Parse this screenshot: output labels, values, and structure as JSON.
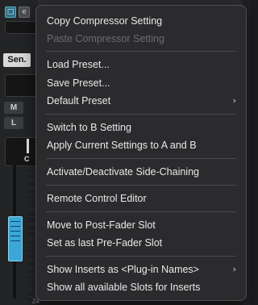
{
  "background": {
    "send_label": "Sen.",
    "mute_label": "M",
    "listen_label": "L",
    "channel_label": "C",
    "scale_label": "24"
  },
  "menu": {
    "items": [
      {
        "label": "Copy Compressor Setting",
        "enabled": true
      },
      {
        "label": "Paste Compressor Setting",
        "enabled": false
      },
      {
        "label": "Load Preset...",
        "enabled": true
      },
      {
        "label": "Save Preset...",
        "enabled": true
      },
      {
        "label": "Default Preset",
        "enabled": true,
        "submenu": true
      },
      {
        "label": "Switch to B Setting",
        "enabled": true
      },
      {
        "label": "Apply Current Settings to A and B",
        "enabled": true
      },
      {
        "label": "Activate/Deactivate Side-Chaining",
        "enabled": true
      },
      {
        "label": "Remote Control Editor",
        "enabled": true
      },
      {
        "label": "Move to Post-Fader Slot",
        "enabled": true
      },
      {
        "label": "Set as last Pre-Fader Slot",
        "enabled": true
      },
      {
        "label": "Show Inserts as <Plug-in Names>",
        "enabled": true,
        "submenu": true
      },
      {
        "label": "Show all available Slots for Inserts",
        "enabled": true
      }
    ],
    "chevron_icon": "chevron-right-icon"
  },
  "colors": {
    "menu_bg": "#2b2b2d",
    "text": "#e9e9ea",
    "disabled_text": "#6c6c70",
    "accent": "#3ca6d8"
  }
}
